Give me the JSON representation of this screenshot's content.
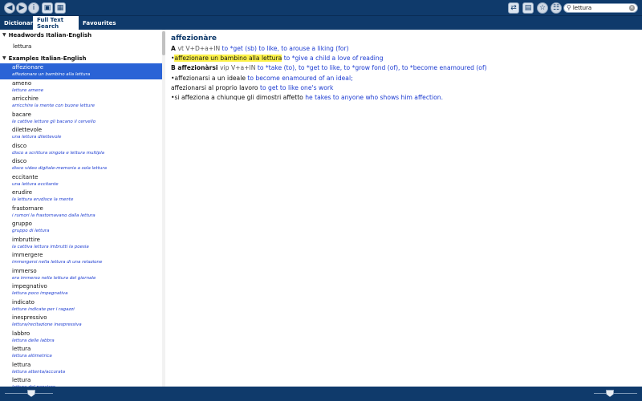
{
  "toolbar": {
    "back_icon": "back-arrow-icon",
    "forward_icon": "forward-arrow-icon",
    "info_icon": "info-icon",
    "cart_icon": "cart-icon",
    "keyboard_icon": "keyboard-icon",
    "swap_icon": "swap-arrows-icon",
    "panel_icon": "panel-icon",
    "star_icon": "star-icon",
    "grid_icon": "grid-icon",
    "search_value": "lettura"
  },
  "tabs": [
    "Dictionary",
    "Full Text Search",
    "Favourites"
  ],
  "active_tab": "Full Text Search",
  "left": {
    "headwords_header": "Headwords Italian-English",
    "headword_item": "lettura",
    "examples_header": "Examples Italian-English",
    "entries": [
      {
        "hw": "affezionare",
        "ex": "affezionare un bambino alla lettura"
      },
      {
        "hw": "ameno",
        "ex": "letture amene"
      },
      {
        "hw": "arricchire",
        "ex": "arricchire la mente con buone letture"
      },
      {
        "hw": "bacare",
        "ex": "le cattive letture gli bacano il cervello"
      },
      {
        "hw": "dilettevole",
        "ex": "una lettura dilettevole"
      },
      {
        "hw": "disco",
        "ex": "disco a scrittura singola e lettura multipla"
      },
      {
        "hw": "disco",
        "ex": "disco video digitale-memoria a sola lettura"
      },
      {
        "hw": "eccitante",
        "ex": "una lettura eccitante"
      },
      {
        "hw": "erudire",
        "ex": "la lettura erudisce la mente"
      },
      {
        "hw": "frastornare",
        "ex": "i rumori la frastornavano dalla lettura"
      },
      {
        "hw": "gruppo",
        "ex": "gruppo di lettura"
      },
      {
        "hw": "imbruttire",
        "ex": "la cattiva lettura imbrutti la poesia"
      },
      {
        "hw": "immergere",
        "ex": "immergersi nella lettura di una relazione"
      },
      {
        "hw": "immerso",
        "ex": "era immerso nella lettura del giornale"
      },
      {
        "hw": "impegnativo",
        "ex": "lettura poco impegnativa"
      },
      {
        "hw": "indicato",
        "ex": "letture indicate per i ragazzi"
      },
      {
        "hw": "inespressivo",
        "ex": "lettura/recitazione inespressiva"
      },
      {
        "hw": "labbro",
        "ex": "lettura delle labbra"
      },
      {
        "hw": "lettura",
        "ex": "lettura altimetrica"
      },
      {
        "hw": "lettura",
        "ex": "lettura attenta/accurata"
      },
      {
        "hw": "lettura",
        "ex": "lettura del pensiero"
      }
    ]
  },
  "right": {
    "title": "affezionàre",
    "lines": [
      [
        {
          "t": "A ",
          "c": "b"
        },
        {
          "t": "vt V+D+a+IN ",
          "c": "gray"
        },
        {
          "t": "to *get (sb) to like, to arouse a liking (for)",
          "c": "blue"
        }
      ],
      [
        {
          "t": "•",
          "c": ""
        },
        {
          "t": "affezionare un bambino alla lettura",
          "c": "hl"
        },
        {
          "t": " to *give a child a love of reading",
          "c": "blue"
        }
      ],
      [
        {
          "t": "B affezionàrsi ",
          "c": "b"
        },
        {
          "t": "vip V+a+IN ",
          "c": "gray"
        },
        {
          "t": "to *take (to), to *get to like, to *grow fond (of), to *become enamoured (of)",
          "c": "blue"
        }
      ],
      [
        {
          "t": "•affezionarsi a un ideale ",
          "c": ""
        },
        {
          "t": "to become enamoured of an ideal;",
          "c": "blue"
        }
      ],
      [
        {
          "t": "affezionarsi al proprio lavoro ",
          "c": ""
        },
        {
          "t": "to get to like one's work",
          "c": "blue"
        }
      ],
      [
        {
          "t": "•si affeziona a chiunque gli dimostri affetto ",
          "c": ""
        },
        {
          "t": "he takes to anyone who shows him affection.",
          "c": "blue"
        }
      ]
    ]
  },
  "colors": {
    "chrome": "#0f3a6b",
    "selection": "#2a63d6",
    "example_blue": "#1b3bd1",
    "highlight": "#fdf24a"
  }
}
